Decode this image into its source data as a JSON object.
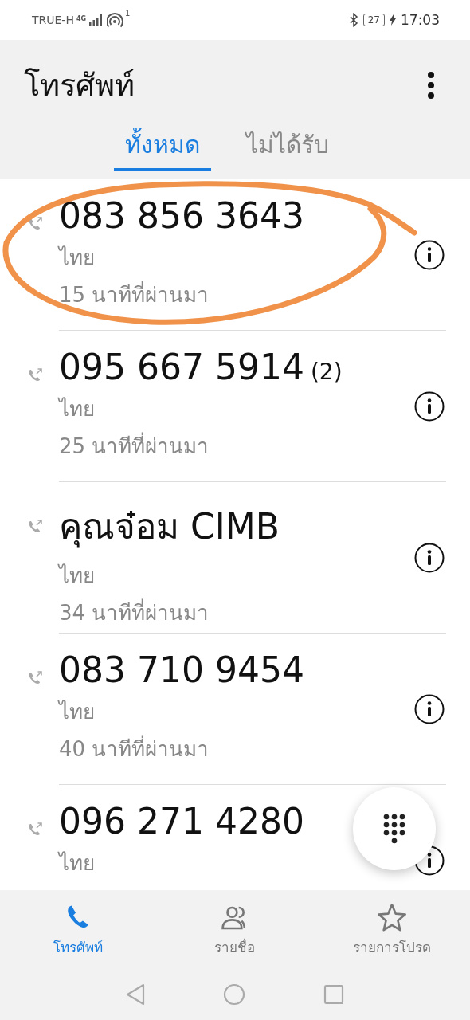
{
  "status_bar": {
    "carrier": "TRUE-H",
    "network": "4G",
    "hotspot_count": "1",
    "battery": "27",
    "charging": true,
    "time": "17:03"
  },
  "app_bar": {
    "title": "โทรศัพท์"
  },
  "tabs": [
    {
      "label": "ทั้งหมด",
      "selected": true
    },
    {
      "label": "ไม่ได้รับ",
      "selected": false
    }
  ],
  "calls": [
    {
      "name": "083 856 3643",
      "location": "ไทย",
      "time": "15 นาทีที่ผ่านมา"
    },
    {
      "name": "095 667 5914",
      "count": "(2)",
      "location": "ไทย",
      "time": "25 นาทีที่ผ่านมา"
    },
    {
      "name": "คุณจ๋อม CIMB",
      "location": "ไทย",
      "time": "34 นาทีที่ผ่านมา"
    },
    {
      "name": "083 710 9454",
      "location": "ไทย",
      "time": "40 นาทีที่ผ่านมา"
    },
    {
      "name": "096 271 4280",
      "location": "ไทย"
    }
  ],
  "bottom_nav": [
    {
      "label": "โทรศัพท์",
      "selected": true
    },
    {
      "label": "รายชื่อ",
      "selected": false
    },
    {
      "label": "รายการโปรด",
      "selected": false
    }
  ]
}
